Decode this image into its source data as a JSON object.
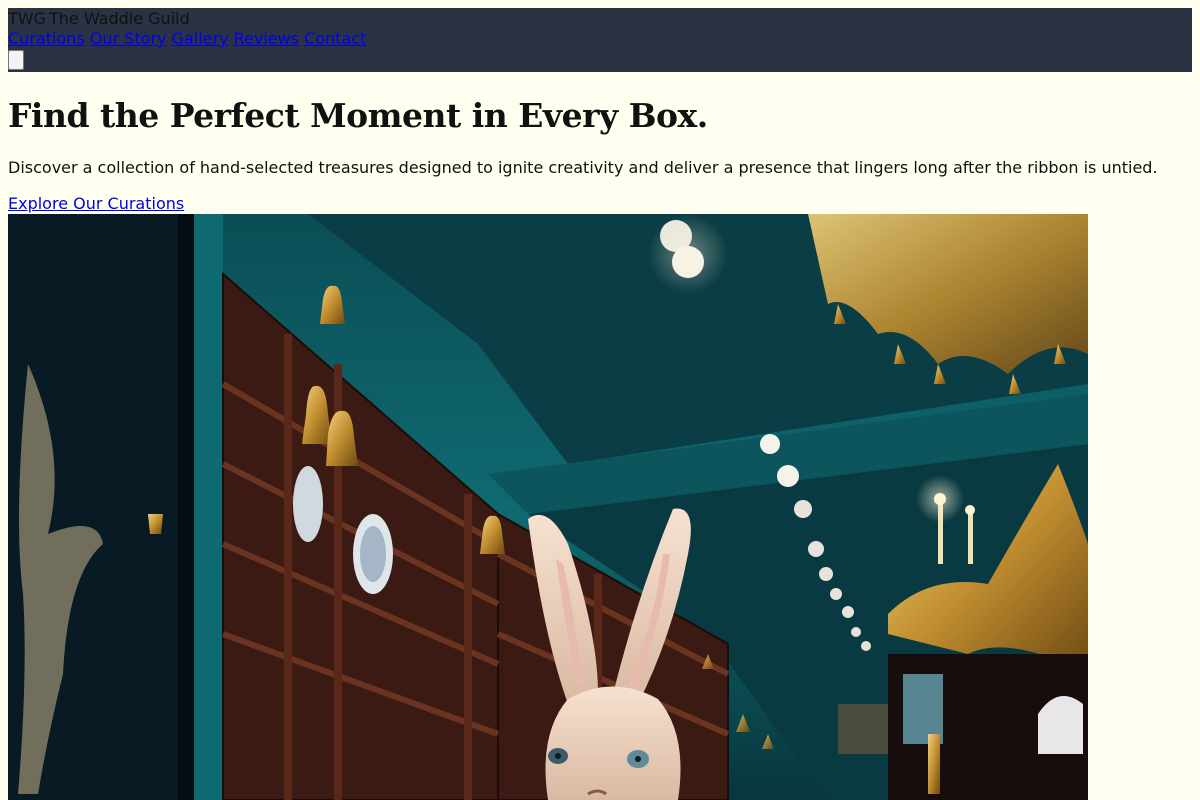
{
  "header": {
    "brand_mark": "TWG",
    "brand_name": "The Waddle Guild",
    "nav": [
      "Curations",
      "Our Story",
      "Gallery",
      "Reviews",
      "Contact"
    ],
    "menu_icon": "menu-toggle-icon",
    "colors": {
      "bar": "#2b3244",
      "link": "#0000ee"
    }
  },
  "hero": {
    "title": "Find the Perfect Moment in Every Box.",
    "subtitle": "Discover a collection of hand-selected treasures designed to ignite creativity and deliver a presence that lingers long after the ribbon is untied.",
    "cta": "Explore Our Curations"
  },
  "colors": {
    "page_bg": "#fffff0",
    "teal_wall": "#0e6a70",
    "wood": "#3a1a12",
    "gold": "#c99a3c"
  }
}
